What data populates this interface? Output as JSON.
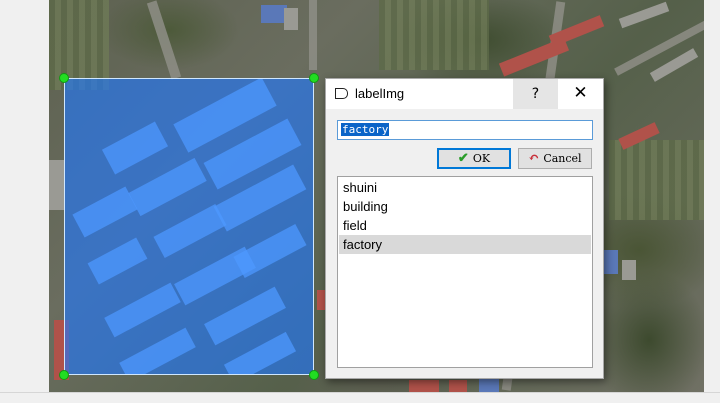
{
  "dialog": {
    "title": "labelImg",
    "help_label": "?",
    "close_label": "✕",
    "input_value": "factory",
    "ok_label": "OK",
    "cancel_label": "Cancel",
    "labels": [
      "shuini",
      "building",
      "field",
      "factory"
    ],
    "selected_index": 3
  },
  "icons": {
    "title": "label-tag-icon",
    "ok": "check-icon",
    "cancel": "undo-arrow-icon"
  },
  "colors": {
    "bbox_fill": "#1e78ff",
    "handle": "#22dd22",
    "selection": "#0a64c8"
  }
}
